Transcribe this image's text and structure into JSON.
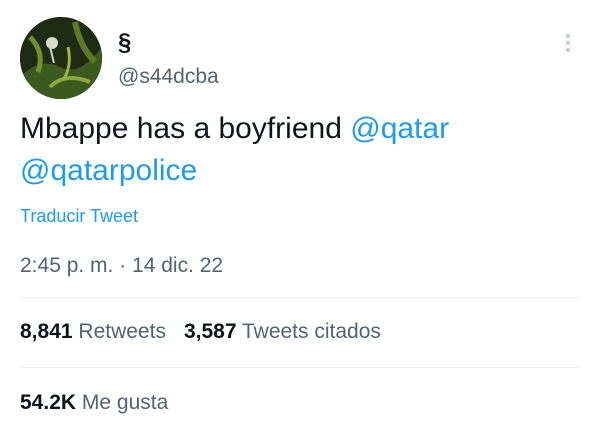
{
  "tweet": {
    "author": {
      "display_name": "§",
      "handle": "@s44dcba"
    },
    "text_parts": {
      "body": "Mbappe has a boyfriend ",
      "mention_1": "@qatar",
      "mention_2": "@qatarpolice"
    },
    "translate_label": "Traducir Tweet",
    "timestamp": "2:45 p. m. · 14 dic. 22",
    "stats": {
      "retweets_value": "8,841",
      "retweets_label": "Retweets",
      "quotes_value": "3,587",
      "quotes_label": "Tweets citados",
      "likes_value": "54.2K",
      "likes_label": "Me gusta"
    }
  },
  "icons": {
    "more": "more-options-icon"
  },
  "colors": {
    "link": "#1d9bf0",
    "text_primary": "#0f1419",
    "text_secondary": "#536471",
    "divider": "#eff3f4"
  }
}
